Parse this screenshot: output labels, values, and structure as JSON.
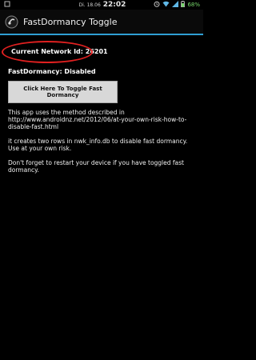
{
  "status_bar": {
    "date": "Di. 18.06",
    "time": "22:02",
    "battery_percent": "68%",
    "icons": [
      "notification-icon",
      "alarm-icon",
      "wifi-icon",
      "signal-icon",
      "battery-icon"
    ]
  },
  "action_bar": {
    "title": "FastDormancy Toggle",
    "icon": "app-icon"
  },
  "content": {
    "network_id": "Current Network Id: 26201",
    "fast_dormancy_status": "FastDormancy: Disabled",
    "toggle_button_label": "Click Here To Toggle Fast Dormancy",
    "paragraph_1": "This app uses the method described in http://www.androidnz.net/2012/06/at-your-own-risk-how-to-disable-fast.html",
    "paragraph_2_line_1": "it creates two rows in nwk_info.db to disable fast dormancy.",
    "paragraph_2_line_2": "Use at your own risk.",
    "paragraph_3": "Don't forget to restart your device if you have toggled fast dormancy."
  },
  "colors": {
    "background": "#000000",
    "accent_line": "#2f9fd3",
    "annotation_oval": "#e02020",
    "button_bg": "#d8d8d8"
  }
}
